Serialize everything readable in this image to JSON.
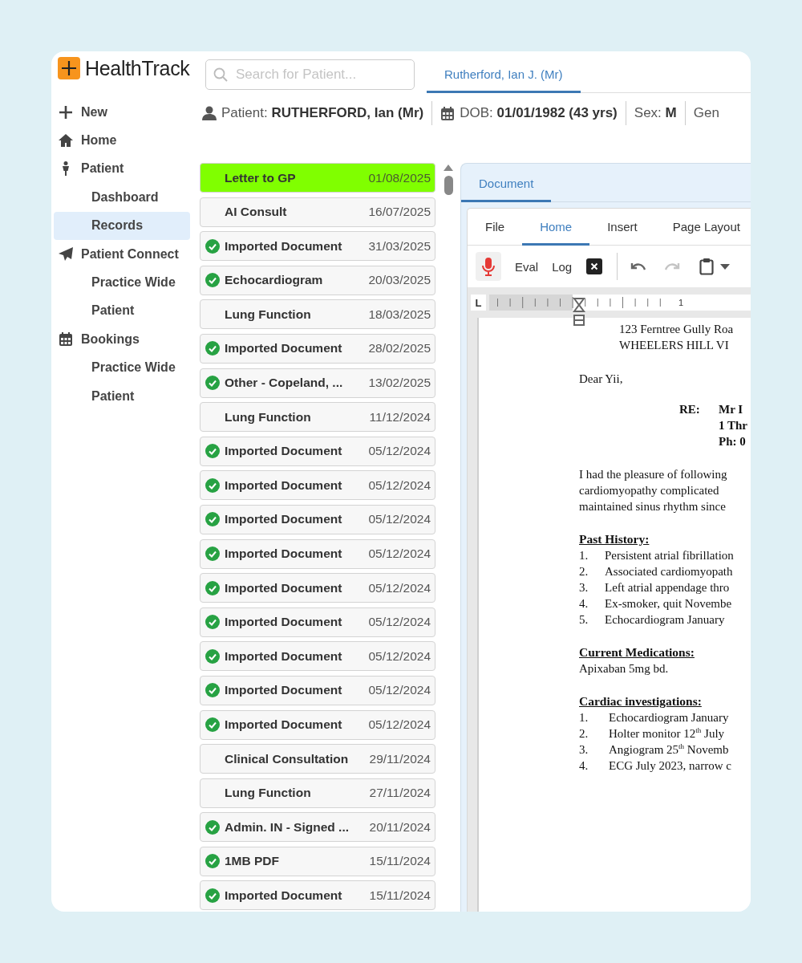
{
  "app": {
    "logo": "HealthTrack"
  },
  "search": {
    "placeholder": "Search for Patient..."
  },
  "patient_tabs": [
    {
      "label": "Rutherford, Ian J. (Mr)",
      "selected": true
    }
  ],
  "patient_bar": [
    {
      "label": "Patient:",
      "value": "RUTHERFORD, Ian (Mr)"
    },
    {
      "label": "DOB:",
      "value": "01/01/1982 (43 yrs)"
    },
    {
      "label": "Sex:",
      "value": "M"
    },
    {
      "label": "Gen"
    }
  ],
  "sidebar": {
    "items": [
      {
        "label": "New",
        "selected": false
      },
      {
        "label": "Home",
        "selected": false
      },
      {
        "label": "Patient",
        "selected": false,
        "children": [
          {
            "label": "Dashboard",
            "selected": false
          },
          {
            "label": "Records",
            "selected": true
          }
        ]
      },
      {
        "label": "Patient Connect",
        "selected": false,
        "children": [
          {
            "label": "Practice Wide",
            "selected": false
          },
          {
            "label": "Patient",
            "selected": false
          }
        ]
      },
      {
        "label": "Bookings",
        "selected": false,
        "children": [
          {
            "label": "Practice Wide",
            "selected": false
          },
          {
            "label": "Patient",
            "selected": false
          }
        ]
      }
    ]
  },
  "records": [
    {
      "title": "Letter to GP",
      "date": "01/08/2025",
      "checked": false,
      "selected": true
    },
    {
      "title": "AI Consult",
      "date": "16/07/2025",
      "checked": false,
      "selected": false
    },
    {
      "title": "Imported Document",
      "date": "31/03/2025",
      "checked": true,
      "selected": false
    },
    {
      "title": "Echocardiogram",
      "date": "20/03/2025",
      "checked": true,
      "selected": false
    },
    {
      "title": "Lung Function",
      "date": "18/03/2025",
      "checked": false,
      "selected": false
    },
    {
      "title": "Imported Document",
      "date": "28/02/2025",
      "checked": true,
      "selected": false
    },
    {
      "title": "Other - Copeland, ...",
      "date": "13/02/2025",
      "checked": true,
      "selected": false
    },
    {
      "title": "Lung Function",
      "date": "11/12/2024",
      "checked": false,
      "selected": false
    },
    {
      "title": "Imported Document",
      "date": "05/12/2024",
      "checked": true,
      "selected": false
    },
    {
      "title": "Imported Document",
      "date": "05/12/2024",
      "checked": true,
      "selected": false
    },
    {
      "title": "Imported Document",
      "date": "05/12/2024",
      "checked": true,
      "selected": false
    },
    {
      "title": "Imported Document",
      "date": "05/12/2024",
      "checked": true,
      "selected": false
    },
    {
      "title": "Imported Document",
      "date": "05/12/2024",
      "checked": true,
      "selected": false
    },
    {
      "title": "Imported Document",
      "date": "05/12/2024",
      "checked": true,
      "selected": false
    },
    {
      "title": "Imported Document",
      "date": "05/12/2024",
      "checked": true,
      "selected": false
    },
    {
      "title": "Imported Document",
      "date": "05/12/2024",
      "checked": true,
      "selected": false
    },
    {
      "title": "Imported Document",
      "date": "05/12/2024",
      "checked": true,
      "selected": false
    },
    {
      "title": "Clinical Consultation",
      "date": "29/11/2024",
      "checked": false,
      "selected": false
    },
    {
      "title": "Lung Function",
      "date": "27/11/2024",
      "checked": false,
      "selected": false
    },
    {
      "title": "Admin. IN - Signed ...",
      "date": "20/11/2024",
      "checked": true,
      "selected": false
    },
    {
      "title": "1MB PDF",
      "date": "15/11/2024",
      "checked": true,
      "selected": false
    },
    {
      "title": "Imported Document",
      "date": "15/11/2024",
      "checked": true,
      "selected": false
    }
  ],
  "document": {
    "tabs": [
      {
        "label": "Document",
        "selected": true
      }
    ],
    "ribbon_tabs": [
      {
        "label": "File",
        "selected": false
      },
      {
        "label": "Home",
        "selected": true
      },
      {
        "label": "Insert",
        "selected": false
      },
      {
        "label": "Page Layout",
        "selected": false
      }
    ],
    "toolbar": {
      "labels": [
        "Eval",
        "Log"
      ],
      "redo_disabled": true
    },
    "ruler": {
      "tab_stop": "L",
      "numbers": [
        "1"
      ]
    },
    "letter": {
      "address": [
        "123 Ferntree Gully Roa",
        "WHEELERS HILL VI"
      ],
      "salutation": "Dear Yii,",
      "re_label": "RE:",
      "re_lines": [
        "Mr I",
        "1 Thr",
        "Ph: 0"
      ],
      "paragraph": [
        "I had the pleasure of following",
        "cardiomyopathy complicated",
        "maintained sinus rhythm since"
      ],
      "sections": [
        {
          "heading": "Past History:",
          "kind": "list",
          "items": [
            {
              "number": "1.",
              "text": "Persistent atrial fibrillation"
            },
            {
              "number": "2.",
              "text": "Associated cardiomyopath"
            },
            {
              "number": "3.",
              "text": "Left atrial appendage thro"
            },
            {
              "number": "4.",
              "text": "Ex-smoker, quit Novembe"
            },
            {
              "number": "5.",
              "text": "Echocardiogram January"
            }
          ]
        },
        {
          "heading": "Current Medications:",
          "kind": "text",
          "items": [
            {
              "text": "Apixaban 5mg bd."
            }
          ]
        },
        {
          "heading": "Cardiac investigations:",
          "kind": "list",
          "items": [
            {
              "number": "1.",
              "text": "Echocardiogram January"
            },
            {
              "number": "2.",
              "text": "Holter monitor 12$^{th}$ July"
            },
            {
              "number": "3.",
              "text": "Angiogram 25$^{th}$ Novemb"
            },
            {
              "number": "4.",
              "text": "ECG July 2023, narrow c"
            }
          ]
        }
      ]
    }
  }
}
